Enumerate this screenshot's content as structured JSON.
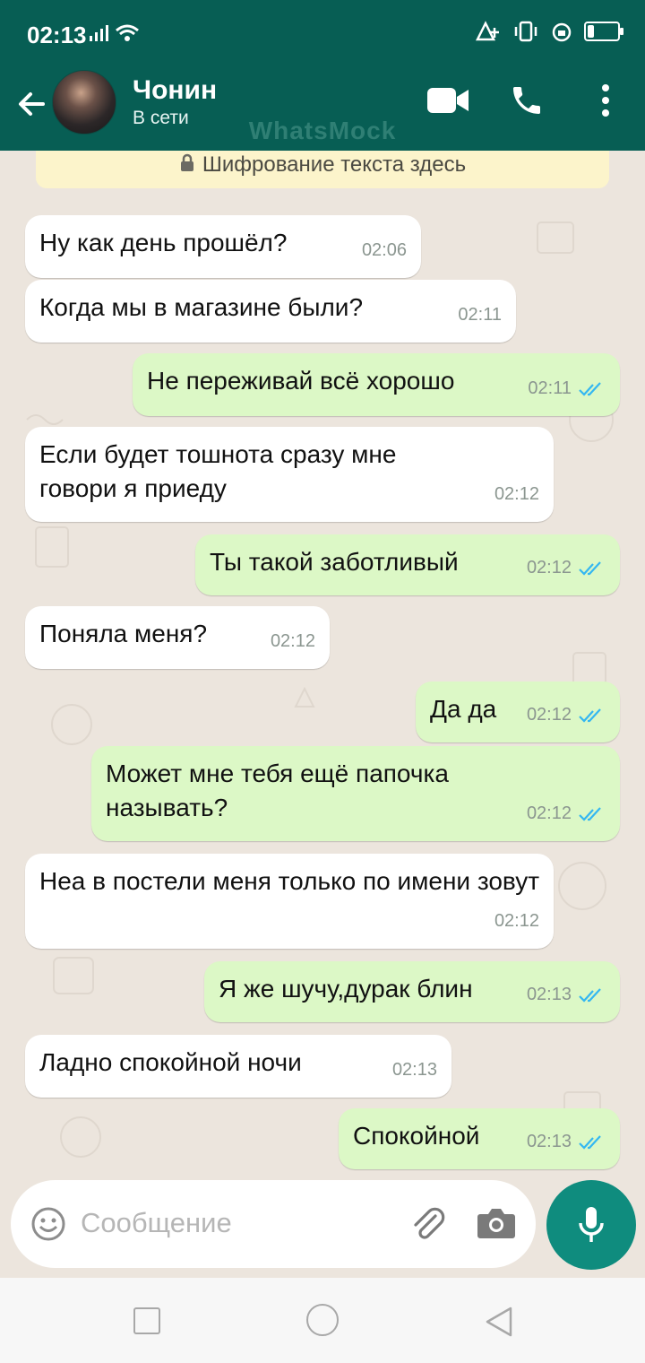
{
  "status_bar": {
    "time": "02:13"
  },
  "header": {
    "contact_name": "Чонин",
    "contact_status": "В сети",
    "watermark": "WhatsMock"
  },
  "chat": {
    "encryption_notice": "Шифрование текста здесь",
    "messages": [
      {
        "direction": "in",
        "text": "Ну как день прошёл?",
        "time": "02:06"
      },
      {
        "direction": "in",
        "text": "Когда мы в магазине были?",
        "time": "02:11"
      },
      {
        "direction": "out",
        "text": "Не переживай всё хорошо",
        "time": "02:11",
        "status": "read"
      },
      {
        "direction": "in",
        "text": "Если будет тошнота сразу мне говори я приеду",
        "time": "02:12"
      },
      {
        "direction": "out",
        "text": "Ты такой заботливый",
        "time": "02:12",
        "status": "read"
      },
      {
        "direction": "in",
        "text": "Поняла меня?",
        "time": "02:12"
      },
      {
        "direction": "out",
        "text": "Да да",
        "time": "02:12",
        "status": "read"
      },
      {
        "direction": "out",
        "text": "Может мне тебя ещё папочка называть?",
        "time": "02:12",
        "status": "read"
      },
      {
        "direction": "in",
        "text": "Неа в постели меня только по имени зовут",
        "time": "02:12"
      },
      {
        "direction": "out",
        "text": "Я же шучу,дурак блин",
        "time": "02:13",
        "status": "read"
      },
      {
        "direction": "in",
        "text": "Ладно спокойной ночи",
        "time": "02:13"
      },
      {
        "direction": "out",
        "text": "Спокойной",
        "time": "02:13",
        "status": "read"
      }
    ]
  },
  "composer": {
    "placeholder": "Сообщение"
  },
  "colors": {
    "header_bg": "#075e54",
    "outgoing_bubble": "#dcf8c6",
    "incoming_bubble": "#ffffff",
    "read_ticks": "#34b7f1",
    "mic_button": "#0f8c7e"
  }
}
